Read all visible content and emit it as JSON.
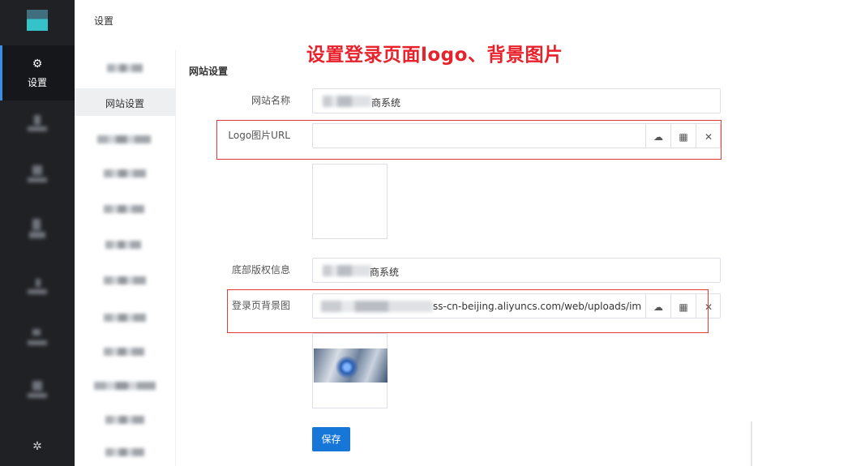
{
  "header": {
    "title": "设置"
  },
  "rail": {
    "active_label": "设置",
    "active_icon": "gear-outline-icon",
    "bottom_icon": "gear-icon",
    "accent": "#3a8ee6"
  },
  "submenu": {
    "active_item": "网站设置"
  },
  "annotation": {
    "banner": "设置登录页面logo、背景图片",
    "color": "#e8222b"
  },
  "panel": {
    "title": "网站设置",
    "fields": {
      "site_name": {
        "label": "网站名称",
        "value_suffix": "商系统"
      },
      "logo_url": {
        "label": "Logo图片URL",
        "value": ""
      },
      "copyright": {
        "label": "底部版权信息",
        "value_suffix": "商系统"
      },
      "login_bg": {
        "label": "登录页背景图",
        "value_suffix": "ss-cn-beijing.aliyuncs.com/web/uploads/imag"
      }
    },
    "save_label": "保存",
    "icons": {
      "upload": "cloud-upload-icon",
      "gallery": "grid-icon",
      "clear": "close-icon"
    }
  }
}
